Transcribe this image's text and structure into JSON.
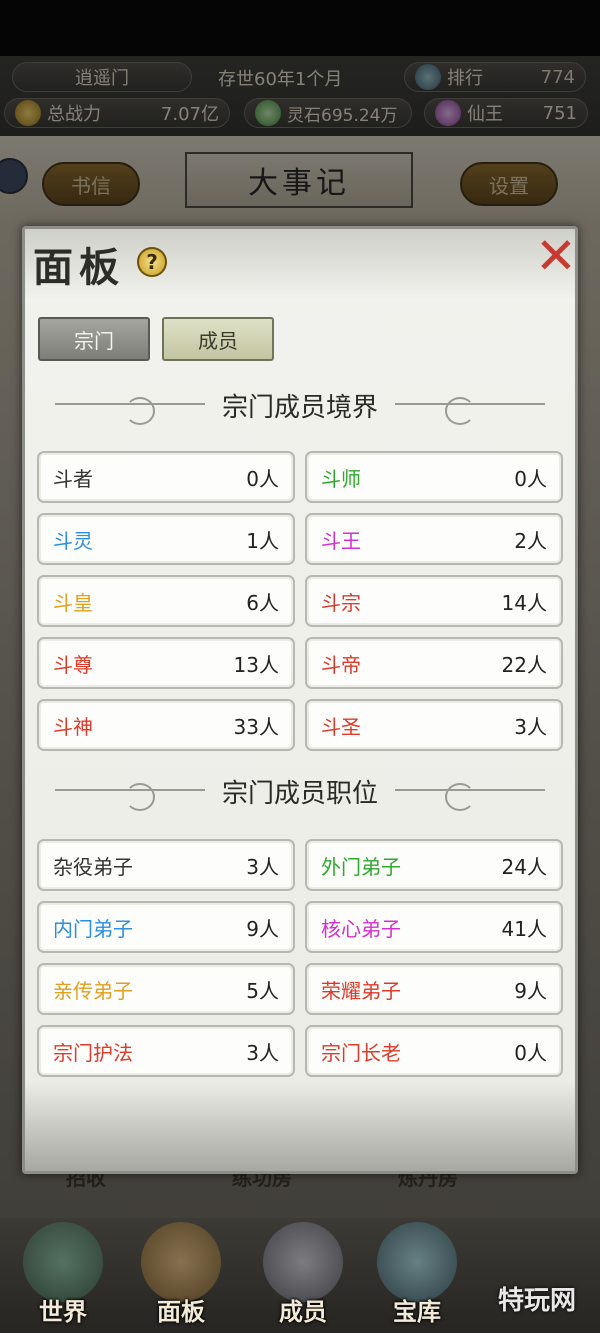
{
  "topbar": {
    "sect_name": "逍遥门",
    "era": "存世60年1个月",
    "rank_label": "排行",
    "rank_value": "774",
    "power_label": "总战力",
    "power_value": "7.07亿",
    "lingshi": "灵石695.24万",
    "xianwang_label": "仙王",
    "xianwang_value": "751"
  },
  "background": {
    "shuxin_button": "书信",
    "title": "大事记",
    "settings_button": "设置",
    "hidden_labels": [
      "招收",
      "练功房",
      "炼丹房"
    ]
  },
  "panel": {
    "title": "面板",
    "help": "?",
    "close": "✕",
    "tabs": [
      {
        "label": "宗门",
        "active": false
      },
      {
        "label": "成员",
        "active": true
      }
    ],
    "realm_section_title": "宗门成员境界",
    "realms": [
      {
        "name": "斗者",
        "count": "0人",
        "color": "#333333"
      },
      {
        "name": "斗师",
        "count": "0人",
        "color": "#2fa82f"
      },
      {
        "name": "斗灵",
        "count": "1人",
        "color": "#2a8fe0"
      },
      {
        "name": "斗王",
        "count": "2人",
        "color": "#d42fd0"
      },
      {
        "name": "斗皇",
        "count": "6人",
        "color": "#e0a020"
      },
      {
        "name": "斗宗",
        "count": "14人",
        "color": "#dd3a2a"
      },
      {
        "name": "斗尊",
        "count": "13人",
        "color": "#dd3a2a"
      },
      {
        "name": "斗帝",
        "count": "22人",
        "color": "#dd3a2a"
      },
      {
        "name": "斗神",
        "count": "33人",
        "color": "#dd3a2a"
      },
      {
        "name": "斗圣",
        "count": "3人",
        "color": "#dd3a2a"
      }
    ],
    "position_section_title": "宗门成员职位",
    "positions": [
      {
        "name": "杂役弟子",
        "count": "3人",
        "color": "#333333"
      },
      {
        "name": "外门弟子",
        "count": "24人",
        "color": "#2fa82f"
      },
      {
        "name": "内门弟子",
        "count": "9人",
        "color": "#2a8fe0"
      },
      {
        "name": "核心弟子",
        "count": "41人",
        "color": "#d42fd0"
      },
      {
        "name": "亲传弟子",
        "count": "5人",
        "color": "#e0a020"
      },
      {
        "name": "荣耀弟子",
        "count": "9人",
        "color": "#dd3a2a"
      },
      {
        "name": "宗门护法",
        "count": "3人",
        "color": "#dd3a2a"
      },
      {
        "name": "宗门长老",
        "count": "0人",
        "color": "#dd3a2a"
      }
    ]
  },
  "bottom_nav": [
    {
      "label": "世界",
      "icon": "world-icon"
    },
    {
      "label": "面板",
      "icon": "scroll-icon"
    },
    {
      "label": "成员",
      "icon": "member-icon"
    },
    {
      "label": "宝库",
      "icon": "treasury-icon"
    }
  ],
  "watermark": "特玩网"
}
